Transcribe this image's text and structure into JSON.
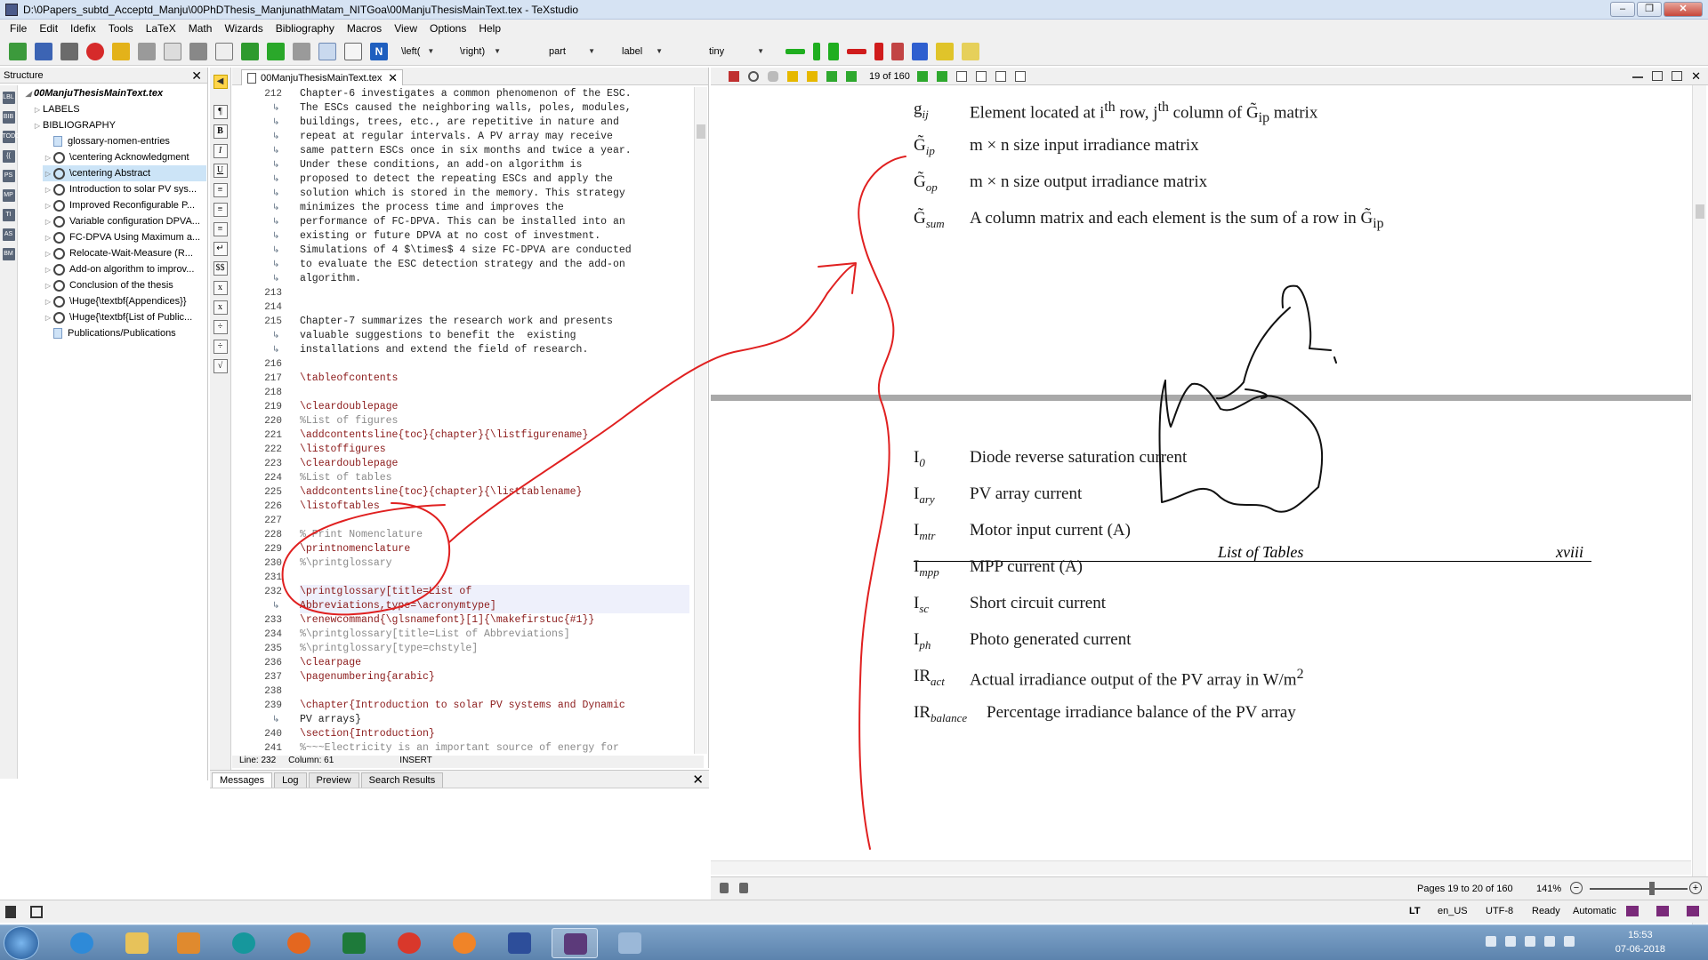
{
  "window": {
    "title": "D:\\0Papers_subtd_Acceptd_Manju\\00PhDThesis_ManjunathMatam_NITGoa\\00ManjuThesisMainText.tex - TeXstudio"
  },
  "menu": [
    "File",
    "Edit",
    "Idefix",
    "Tools",
    "LaTeX",
    "Math",
    "Wizards",
    "Bibliography",
    "Macros",
    "View",
    "Options",
    "Help"
  ],
  "toolbar": {
    "combos": [
      "\\left(",
      "\\right)",
      "part",
      "label",
      "tiny"
    ]
  },
  "structure": {
    "title": "Structure",
    "items": [
      {
        "label": "00ManjuThesisMainText.tex",
        "kind": "root"
      },
      {
        "label": "LABELS",
        "kind": "folder"
      },
      {
        "label": "BIBLIOGRAPHY",
        "kind": "folder"
      },
      {
        "label": "glossary-nomen-entries",
        "kind": "doc"
      },
      {
        "label": "\\centering Acknowledgment",
        "kind": "sec"
      },
      {
        "label": "\\centering Abstract",
        "kind": "sec",
        "selected": true
      },
      {
        "label": "Introduction to solar PV sys...",
        "kind": "sec"
      },
      {
        "label": "Improved Reconfigurable P...",
        "kind": "sec"
      },
      {
        "label": "Variable configuration DPVA...",
        "kind": "sec"
      },
      {
        "label": "FC-DPVA Using Maximum a...",
        "kind": "sec"
      },
      {
        "label": "Relocate-Wait-Measure (R...",
        "kind": "sec"
      },
      {
        "label": "Add-on algorithm to improv...",
        "kind": "sec"
      },
      {
        "label": "Conclusion of the thesis",
        "kind": "sec"
      },
      {
        "label": "\\Huge{\\textbf{Appendices}}",
        "kind": "sec"
      },
      {
        "label": "\\Huge{\\textbf{List of Public...",
        "kind": "sec"
      },
      {
        "label": "Publications/Publications",
        "kind": "doc"
      }
    ],
    "side_icons": [
      "LBL",
      "BIB",
      "TODO",
      "{{",
      "PS",
      "MP",
      "TI",
      "AS",
      "BM"
    ]
  },
  "editor": {
    "tab": "00ManjuThesisMainText.tex",
    "lines": [
      {
        "n": "212",
        "t": "Chapter-6 investigates a common phenomenon of the ESC."
      },
      {
        "n": "",
        "t": "The ESCs caused the neighboring walls, poles, modules,"
      },
      {
        "n": "",
        "t": "buildings, trees, etc., are repetitive in nature and"
      },
      {
        "n": "",
        "t": "repeat at regular intervals. A PV array may receive"
      },
      {
        "n": "",
        "t": "same pattern ESCs once in six months and twice a year."
      },
      {
        "n": "",
        "t": "Under these conditions, an add-on algorithm is"
      },
      {
        "n": "",
        "t": "proposed to detect the repeating ESCs and apply the"
      },
      {
        "n": "",
        "t": "solution which is stored in the memory. This strategy"
      },
      {
        "n": "",
        "t": "minimizes the process time and improves the"
      },
      {
        "n": "",
        "t": "performance of FC-DPVA. This can be installed into an"
      },
      {
        "n": "",
        "t": "existing or future DPVA at no cost of investment."
      },
      {
        "n": "",
        "t": "Simulations of 4 $\\times$ 4 size FC-DPVA are conducted"
      },
      {
        "n": "",
        "t": "to evaluate the ESC detection strategy and the add-on"
      },
      {
        "n": "",
        "t": "algorithm."
      },
      {
        "n": "213",
        "t": ""
      },
      {
        "n": "214",
        "t": ""
      },
      {
        "n": "215",
        "t": "Chapter-7 summarizes the research work and presents"
      },
      {
        "n": "",
        "t": "valuable suggestions to benefit the  existing"
      },
      {
        "n": "",
        "t": "installations and extend the field of research."
      },
      {
        "n": "216",
        "t": ""
      },
      {
        "n": "217",
        "t": "\\tableofcontents",
        "c": "cmd"
      },
      {
        "n": "218",
        "t": ""
      },
      {
        "n": "219",
        "t": "\\cleardoublepage",
        "c": "cmd"
      },
      {
        "n": "220",
        "t": "%List of figures",
        "c": "cmt"
      },
      {
        "n": "221",
        "t": "\\addcontentsline{toc}{chapter}{\\listfigurename}",
        "c": "cmd"
      },
      {
        "n": "222",
        "t": "\\listoffigures",
        "c": "cmd"
      },
      {
        "n": "223",
        "t": "\\cleardoublepage",
        "c": "cmd"
      },
      {
        "n": "224",
        "t": "%List of tables",
        "c": "cmt"
      },
      {
        "n": "225",
        "t": "\\addcontentsline{toc}{chapter}{\\listtablename}",
        "c": "cmd"
      },
      {
        "n": "226",
        "t": "\\listoftables",
        "c": "cmd"
      },
      {
        "n": "227",
        "t": ""
      },
      {
        "n": "228",
        "t": "% Print Nomenclature",
        "c": "cmt"
      },
      {
        "n": "229",
        "t": "\\printnomenclature",
        "c": "cmd"
      },
      {
        "n": "230",
        "t": "%\\printglossary",
        "c": "cmt"
      },
      {
        "n": "231",
        "t": ""
      },
      {
        "n": "232",
        "t": "\\printglossary[title=List of",
        "c": "cmd cur"
      },
      {
        "n": "",
        "t": "Abbreviations,type=\\acronymtype]",
        "c": "cmd cur"
      },
      {
        "n": "233",
        "t": "\\renewcommand{\\glsnamefont}[1]{\\makefirstuc{#1}}",
        "c": "cmd"
      },
      {
        "n": "234",
        "t": "%\\printglossary[title=List of Abbreviations]",
        "c": "cmt"
      },
      {
        "n": "235",
        "t": "%\\printglossary[type=chstyle]",
        "c": "cmt"
      },
      {
        "n": "236",
        "t": "\\clearpage",
        "c": "cmd"
      },
      {
        "n": "237",
        "t": "\\pagenumbering{arabic}",
        "c": "cmd"
      },
      {
        "n": "238",
        "t": ""
      },
      {
        "n": "239",
        "t": "\\chapter{Introduction to solar PV systems and Dynamic",
        "c": "cmd"
      },
      {
        "n": "",
        "t": "PV arrays}"
      },
      {
        "n": "240",
        "t": "\\section{Introduction}",
        "c": "cmd"
      },
      {
        "n": "241",
        "t": "%~~~Electricity is an important source of energy for",
        "c": "cmt"
      }
    ],
    "status": {
      "line": "Line: 232",
      "column": "Column: 61",
      "mode": "INSERT"
    }
  },
  "messages": {
    "tabs": [
      "Messages",
      "Log",
      "Preview",
      "Search Results"
    ]
  },
  "pdf": {
    "page_indicator": "19 of 160",
    "rows_top": [
      {
        "sym": "g",
        "sub": "ij",
        "desc": "Element located at i<sup>th</sup> row, j<sup>th</sup> column of G̃<sub>ip</sub> matrix"
      },
      {
        "sym": "G̃",
        "sub": "ip",
        "desc": "m × n size input irradiance matrix"
      },
      {
        "sym": "G̃",
        "sub": "op",
        "desc": "m × n size output irradiance matrix"
      },
      {
        "sym": "G̃",
        "sub": "sum",
        "desc": "A column matrix and each element is the sum of a row in G̃<sub>ip</sub>"
      }
    ],
    "list_title": "List of Tables",
    "list_page": "xviii",
    "rows_bottom": [
      {
        "sym": "I",
        "sub": "0",
        "desc": "Diode reverse saturation current"
      },
      {
        "sym": "I",
        "sub": "ary",
        "desc": "PV array current"
      },
      {
        "sym": "I",
        "sub": "mtr",
        "desc": "Motor input current (A)"
      },
      {
        "sym": "I",
        "sub": "mpp",
        "desc": "MPP current (A)"
      },
      {
        "sym": "I",
        "sub": "sc",
        "desc": "Short circuit current"
      },
      {
        "sym": "I",
        "sub": "ph",
        "desc": "Photo generated current"
      },
      {
        "sym": "IR",
        "sub": "act",
        "desc": "Actual irradiance output of the PV array in W/m<sup>2</sup>"
      },
      {
        "sym": "IR",
        "sub": "balance",
        "desc": "Percentage irradiance balance of the PV array"
      }
    ],
    "pages_label": "Pages 19 to 20 of 160",
    "zoom": "141%"
  },
  "statusbar": {
    "lang": "en_US",
    "encoding": "UTF-8",
    "state": "Ready",
    "mode": "Automatic"
  },
  "taskbar": {
    "time": "15:53",
    "date": "07-06-2018"
  },
  "colors": {
    "annotation": "#e02020",
    "ink": "#111111",
    "selection": "#cce4f7"
  }
}
